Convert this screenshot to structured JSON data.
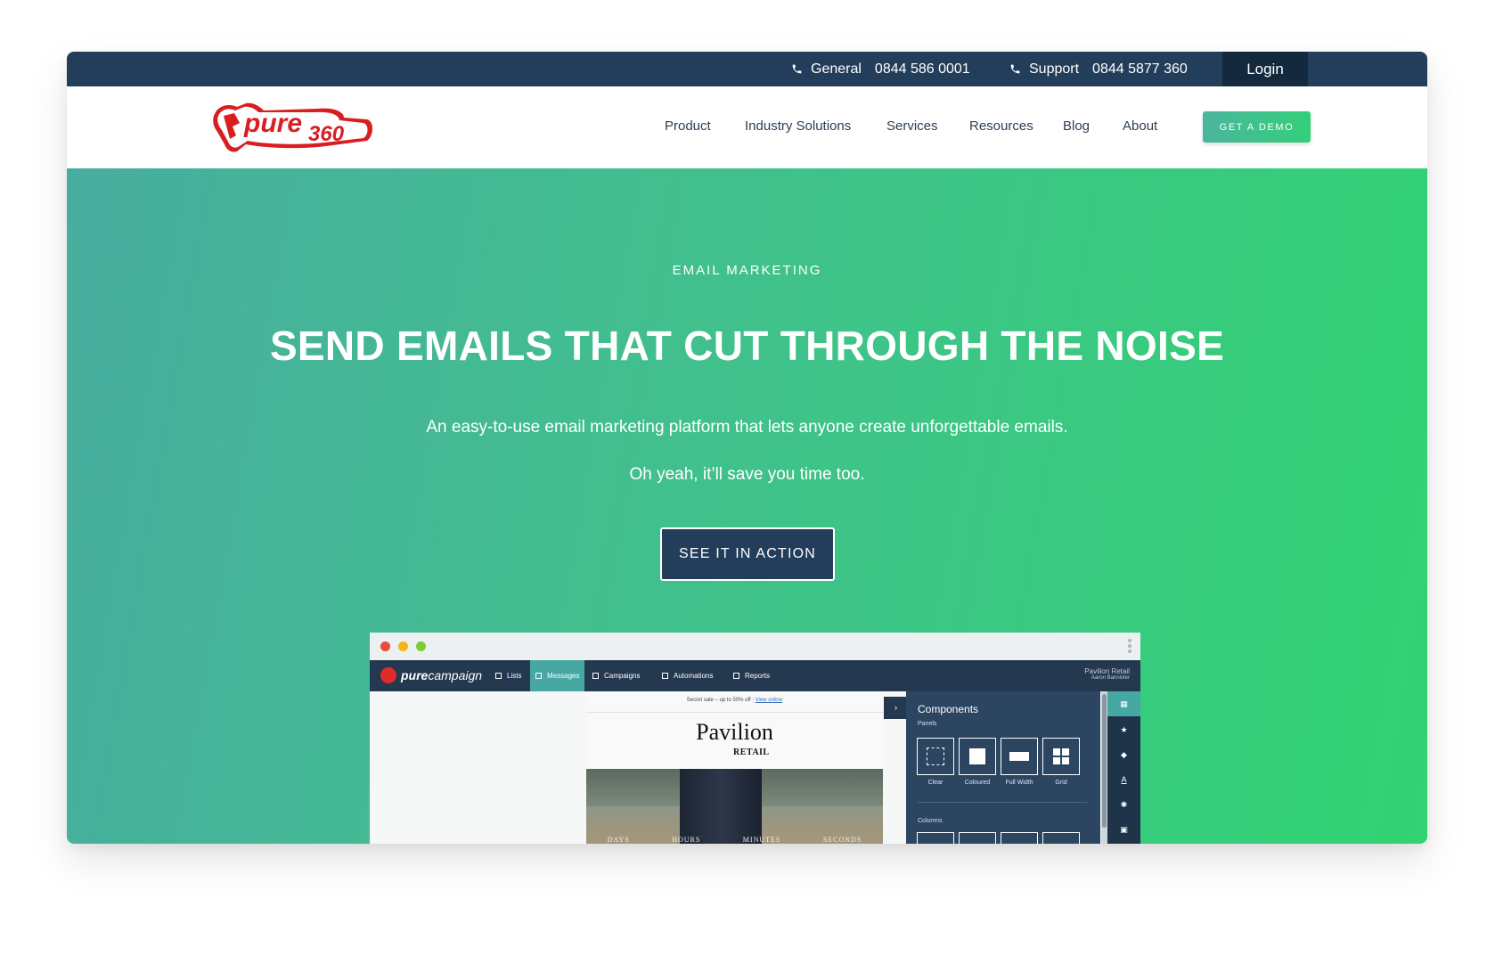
{
  "topbar": {
    "general_label": "General",
    "general_phone": "0844 586 0001",
    "support_label": "Support",
    "support_phone": "0844 5877 360",
    "login_label": "Login"
  },
  "logo": {
    "wordmark": "pure360"
  },
  "nav": {
    "items": [
      {
        "label": "Product"
      },
      {
        "label": "Industry Solutions"
      },
      {
        "label": "Services"
      },
      {
        "label": "Resources"
      },
      {
        "label": "Blog"
      },
      {
        "label": "About"
      }
    ],
    "demo_label": "GET A DEMO"
  },
  "hero": {
    "eyebrow": "EMAIL MARKETING",
    "headline": "SEND EMAILS THAT CUT THROUGH THE NOISE",
    "sub1": "An easy-to-use email marketing platform that lets anyone create unforgettable emails.",
    "sub2": "Oh yeah, it’ll save you time too.",
    "cta_label": "SEE IT IN ACTION"
  },
  "app": {
    "brand_bold": "pure",
    "brand_light": "campaign",
    "tabs": [
      {
        "label": "Lists"
      },
      {
        "label": "Messages"
      },
      {
        "label": "Campaigns"
      },
      {
        "label": "Automations"
      },
      {
        "label": "Reports"
      }
    ],
    "user_company": "Pavilion Retail",
    "user_name": "Aaron Bannister",
    "email": {
      "preheader": "Secret sale – up to 50% off",
      "view_online": "View online",
      "brand": "Pavilion",
      "brand_sub": "RETAIL",
      "countdown": [
        "DAYS",
        "HOURS",
        "MINUTES",
        "SECONDS"
      ]
    },
    "components": {
      "title": "Components",
      "panels_label": "Panels",
      "items": [
        {
          "label": "Clear"
        },
        {
          "label": "Coloured"
        },
        {
          "label": "Full Width"
        },
        {
          "label": "Grid"
        }
      ],
      "columns_label": "Columns"
    }
  },
  "colors": {
    "topbar": "#223e5a",
    "login_bg": "#14283e",
    "hero_start": "#48ad9f",
    "hero_end": "#31d373",
    "cta_bg": "#223e5a",
    "logo_red": "#d81e20"
  }
}
